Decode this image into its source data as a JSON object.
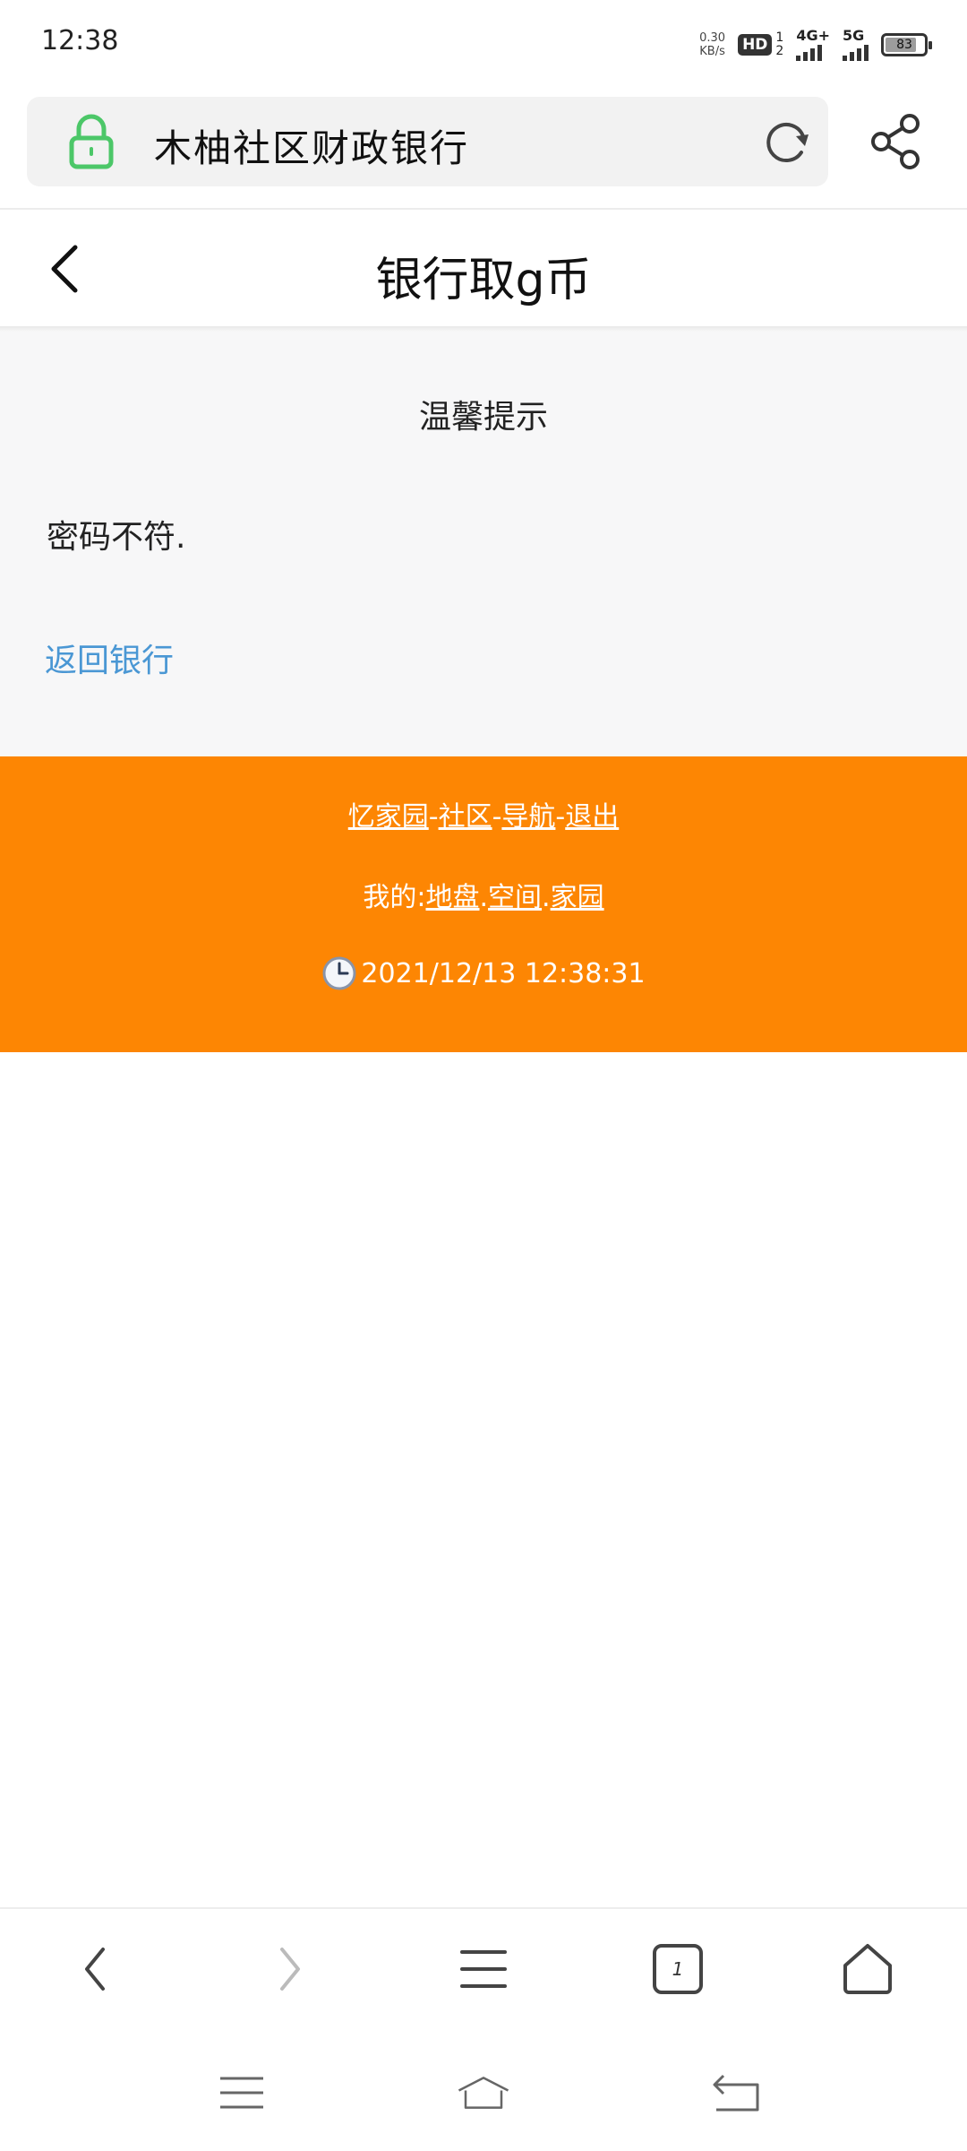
{
  "status_bar": {
    "time": "12:38",
    "net_speed_value": "0.30",
    "net_speed_unit": "KB/s",
    "hd_label": "HD",
    "hd_sub_top": "1",
    "hd_sub_bottom": "2",
    "network1": "4G+",
    "network2": "5G",
    "battery": "83",
    "battery_level": 0.83
  },
  "address_bar": {
    "title": "木柚社区财政银行",
    "secure_color": "#4cc768"
  },
  "header": {
    "title": "银行取g币"
  },
  "content": {
    "notice_title": "温馨提示",
    "message": "密码不符.",
    "back_link": "返回银行"
  },
  "footer": {
    "row1": [
      "忆家园",
      "社区",
      "导航",
      "退出"
    ],
    "row1_separator": "-",
    "row2_prefix": "我的:",
    "row2": [
      "地盘",
      "空间",
      "家园"
    ],
    "row2_separator": ".",
    "timestamp": "2021/12/13 12:38:31",
    "background_color": "#fd8603"
  },
  "toolbar": {
    "tabs_count": "1"
  },
  "icons": {
    "lock": "lock-icon",
    "refresh": "refresh-icon",
    "share": "share-icon",
    "back": "chevron-left-icon",
    "clock": "clock-icon",
    "forward": "chevron-right-icon",
    "menu": "menu-icon",
    "tabs": "tabs-icon",
    "home": "home-icon"
  },
  "colors": {
    "link": "#4a97d4",
    "accent_orange": "#fd8603"
  }
}
